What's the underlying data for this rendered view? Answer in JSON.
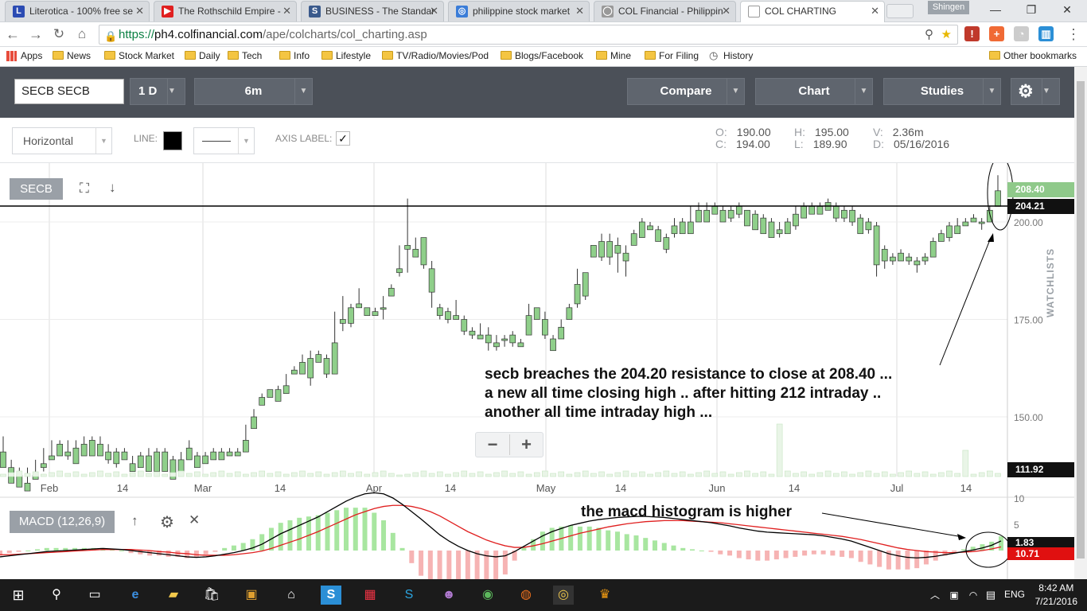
{
  "browser": {
    "tabs": [
      {
        "title": "Literotica - 100% free se",
        "icon": "literotica-favicon",
        "color": "#2b4bb3",
        "glyph": "L"
      },
      {
        "title": "The Rothschild Empire -",
        "icon": "youtube-favicon",
        "color": "#e02020",
        "glyph": "▶"
      },
      {
        "title": "BUSINESS - The Standar",
        "icon": "standard-favicon",
        "color": "#3a5a8c",
        "glyph": "S"
      },
      {
        "title": "philippine stock market",
        "icon": "globe-favicon",
        "color": "#3b7dd8",
        "glyph": "◎"
      },
      {
        "title": "COL Financial - Philippin",
        "icon": "col-favicon",
        "color": "#999999",
        "glyph": "◯"
      },
      {
        "title": "COL CHARTING",
        "icon": "blank-page-favicon",
        "color": "#ffffff",
        "glyph": ""
      }
    ],
    "profile_name": "Shingen",
    "url_scheme": "https://",
    "url_host": "ph4.colfinancial.com",
    "url_path": "/ape/colcharts/col_charting.asp",
    "bookmarks": [
      {
        "label": "Apps",
        "type": "apps"
      },
      {
        "label": "News"
      },
      {
        "label": "Stock Market"
      },
      {
        "label": "Daily"
      },
      {
        "label": "Tech"
      },
      {
        "label": "Info"
      },
      {
        "label": "Lifestyle"
      },
      {
        "label": "TV/Radio/Movies/Pod"
      },
      {
        "label": "Blogs/Facebook"
      },
      {
        "label": "Mine"
      },
      {
        "label": "For Filing"
      },
      {
        "label": "History",
        "type": "history"
      }
    ],
    "other_bookmarks": "Other bookmarks"
  },
  "toolbar": {
    "symbol": "SECB SECB",
    "interval": "1 D",
    "range": "6m",
    "compare": "Compare",
    "chart": "Chart",
    "studies": "Studies"
  },
  "drawing": {
    "tool": "Horizontal",
    "line_label": "LINE:",
    "line_color": "#000000",
    "axis_label": "AXIS LABEL:",
    "axis_checked": "✓"
  },
  "ohlc": {
    "o_key": "O:",
    "o": "190.00",
    "c_key": "C:",
    "c": "194.00",
    "h_key": "H:",
    "h": "195.00",
    "l_key": "L:",
    "l": "189.90",
    "v_key": "V:",
    "v": "2.36m",
    "d_key": "D:",
    "d": "05/16/2016"
  },
  "chart_panel": {
    "symbol_label": "SECB",
    "last_price_label": "208.40",
    "resistance_label": "204.21",
    "volume_label": "111.92",
    "watchlists": "WATCHLISTS",
    "zoom_out": "−",
    "zoom_in": "+",
    "annotation_main": "secb breaches the 204.20 resistance to close at 208.40 ...\na new all time closing high .. after hitting 212 intraday ..\nanother all time intraday high ...",
    "annotation_macd": "the macd histogram is higher",
    "macd_label": "MACD (12,26,9)",
    "macd_value_black": "1.83",
    "macd_value_red": "10.71",
    "colors": {
      "up": "#8fcf8a",
      "down": "#b8362b",
      "macd": "#000000",
      "signal": "#e01f1f",
      "hist_up": "#a8e6a0",
      "hist_down": "#f6b3b3"
    }
  },
  "chart_data": {
    "type": "candlestick",
    "price_axis_ticks": [
      "200.00",
      "175.00",
      "150.00"
    ],
    "macd_axis_ticks": [
      "10",
      "5"
    ],
    "x_ticks": [
      "Feb",
      "14",
      "Mar",
      "14",
      "Apr",
      "14",
      "May",
      "14",
      "Jun",
      "14",
      "Jul",
      "14"
    ],
    "resistance": 204.2,
    "price_range": [
      111.92,
      212
    ],
    "macd_range": [
      -4,
      12
    ],
    "candles": [
      [
        141,
        145,
        138,
        137
      ],
      [
        137,
        139,
        134,
        133
      ],
      [
        135,
        137,
        134,
        132
      ],
      [
        133,
        137,
        132,
        131
      ],
      [
        135,
        139,
        134,
        134
      ],
      [
        138,
        142,
        136,
        137
      ],
      [
        140,
        144,
        139,
        139
      ],
      [
        143,
        144,
        140,
        140
      ],
      [
        141,
        144,
        139,
        140
      ],
      [
        142,
        144,
        139,
        138
      ],
      [
        143,
        145,
        141,
        140
      ],
      [
        144,
        145,
        140,
        140
      ],
      [
        143,
        145,
        140,
        140
      ],
      [
        141,
        143,
        138,
        139
      ],
      [
        141,
        142,
        137,
        138
      ],
      [
        141,
        142,
        139,
        139
      ],
      [
        138,
        140,
        136,
        136
      ],
      [
        140,
        141,
        138,
        137
      ],
      [
        140,
        142,
        137,
        136
      ],
      [
        141,
        142,
        137,
        136
      ],
      [
        141,
        142,
        138,
        136
      ],
      [
        139,
        140,
        136,
        134
      ],
      [
        139,
        141,
        137,
        136
      ],
      [
        142,
        144,
        139,
        139
      ],
      [
        140,
        141,
        137,
        137
      ],
      [
        140,
        141,
        138,
        138
      ],
      [
        141,
        142,
        139,
        139
      ],
      [
        141,
        142,
        140,
        139
      ],
      [
        141,
        142,
        140,
        140
      ],
      [
        141,
        142,
        140,
        140
      ],
      [
        144,
        148,
        144,
        141
      ],
      [
        150,
        152,
        147,
        147
      ],
      [
        155,
        156,
        154,
        153
      ],
      [
        157,
        157,
        156,
        155
      ],
      [
        157,
        158,
        155,
        154
      ],
      [
        158,
        161,
        157,
        156
      ],
      [
        162,
        163,
        162,
        161
      ],
      [
        164,
        166,
        163,
        161
      ],
      [
        165,
        167,
        158,
        160
      ],
      [
        166,
        167,
        165,
        164
      ],
      [
        165,
        166,
        160,
        161
      ],
      [
        169,
        177,
        168,
        161
      ],
      [
        175,
        181,
        172,
        174
      ],
      [
        178,
        179,
        173,
        174
      ],
      [
        179,
        183,
        179,
        178
      ],
      [
        178,
        178,
        176,
        176
      ],
      [
        177,
        178,
        176,
        176
      ],
      [
        178,
        181,
        175,
        178
      ],
      [
        183,
        184,
        182,
        181
      ],
      [
        188,
        194,
        186,
        187
      ],
      [
        194,
        206,
        187,
        193
      ],
      [
        193,
        196,
        191,
        191
      ],
      [
        196,
        196,
        188,
        189
      ],
      [
        188,
        190,
        178,
        182
      ],
      [
        178,
        179,
        175,
        176
      ],
      [
        177,
        178,
        174,
        175
      ],
      [
        176,
        180,
        175,
        175
      ],
      [
        175,
        176,
        171,
        172
      ],
      [
        172,
        173,
        170,
        171
      ],
      [
        171,
        174,
        170,
        170
      ],
      [
        171,
        173,
        167,
        169
      ],
      [
        169,
        171,
        167,
        168
      ],
      [
        170,
        171,
        168,
        170
      ],
      [
        171,
        172,
        168,
        169
      ],
      [
        169,
        170,
        168,
        168
      ],
      [
        176,
        179,
        172,
        171
      ],
      [
        178,
        178,
        175,
        175
      ],
      [
        175,
        177,
        170,
        171
      ],
      [
        170,
        171,
        167,
        167
      ],
      [
        173,
        175,
        172,
        170
      ],
      [
        178,
        179,
        176,
        175
      ],
      [
        184,
        188,
        178,
        179
      ],
      [
        187,
        187,
        180,
        181
      ],
      [
        194,
        194,
        191,
        191
      ],
      [
        195,
        197,
        190,
        191
      ],
      [
        195,
        197,
        189,
        191
      ],
      [
        194,
        196,
        187,
        192
      ],
      [
        192,
        194,
        186,
        190
      ],
      [
        197,
        198,
        194,
        194
      ],
      [
        200,
        201,
        197,
        196
      ],
      [
        199,
        200,
        198,
        198
      ],
      [
        198,
        199,
        197,
        195
      ],
      [
        196,
        197,
        192,
        193
      ],
      [
        199,
        201,
        196,
        197
      ],
      [
        200,
        201,
        198,
        197
      ],
      [
        200,
        204,
        199,
        197
      ],
      [
        203,
        205,
        201,
        200
      ],
      [
        203,
        205,
        201,
        200
      ],
      [
        204,
        205,
        203,
        202
      ],
      [
        203,
        204,
        201,
        200
      ],
      [
        203,
        204,
        200,
        201
      ],
      [
        204,
        205,
        201,
        202
      ],
      [
        203,
        203,
        201,
        199
      ],
      [
        202,
        203,
        199,
        198
      ],
      [
        201,
        202,
        198,
        197
      ],
      [
        200,
        201,
        196,
        196
      ],
      [
        198,
        200,
        196,
        197
      ],
      [
        200,
        201,
        198,
        197
      ],
      [
        202,
        204,
        198,
        199
      ],
      [
        204,
        205,
        203,
        201
      ],
      [
        204,
        205,
        203,
        202
      ],
      [
        204,
        205,
        202,
        202
      ],
      [
        205,
        206,
        204,
        203
      ],
      [
        204,
        205,
        200,
        201
      ],
      [
        203,
        204,
        200,
        201
      ],
      [
        203,
        204,
        199,
        200
      ],
      [
        201,
        202,
        197,
        197
      ],
      [
        200,
        201,
        197,
        198
      ],
      [
        199,
        200,
        186,
        189
      ],
      [
        193,
        194,
        188,
        190
      ],
      [
        191,
        192,
        189,
        190
      ],
      [
        192,
        193,
        190,
        190
      ],
      [
        191,
        192,
        189,
        190
      ],
      [
        190,
        191,
        187,
        189
      ],
      [
        191,
        192,
        189,
        190
      ],
      [
        195,
        196,
        192,
        191
      ],
      [
        197,
        198,
        195,
        195
      ],
      [
        199,
        200,
        195,
        196
      ],
      [
        199,
        201,
        197,
        197
      ],
      [
        200,
        201,
        199,
        199
      ],
      [
        201,
        202,
        200,
        200
      ],
      [
        200,
        201,
        198,
        200
      ],
      [
        203,
        204,
        200,
        200
      ],
      [
        208,
        212,
        207,
        204
      ]
    ],
    "macd": [
      -1.2,
      -1.0,
      -0.8,
      -0.6,
      -0.4,
      -0.2,
      -0.1,
      0.0,
      0.1,
      0.2,
      0.3,
      0.4,
      0.3,
      0.2,
      0.0,
      -0.2,
      -0.4,
      -0.6,
      -0.8,
      -1.0,
      -1.2,
      -1.3,
      -1.2,
      -1.0,
      -0.7,
      -0.4,
      0.0,
      0.5,
      1.2,
      2.2,
      3.2,
      4.0,
      4.8,
      5.6,
      6.4,
      7.4,
      8.4,
      9.4,
      10.2,
      10.8,
      11.0,
      10.8,
      10.0,
      8.8,
      7.4,
      6.0,
      4.5,
      3.0,
      1.8,
      0.8,
      0.0,
      -0.6,
      -1.0,
      -1.2,
      -1.0,
      -0.2,
      0.8,
      1.8,
      2.8,
      3.6,
      4.2,
      4.8,
      5.2,
      5.6,
      5.9,
      6.1,
      6.3,
      6.4,
      6.5,
      6.5,
      6.4,
      6.3,
      6.1,
      5.9,
      5.7,
      5.5,
      5.3,
      5.0,
      4.7,
      4.3,
      4.0,
      3.7,
      3.5,
      3.4,
      3.3,
      3.2,
      3.1,
      3.0,
      2.8,
      2.5,
      2.2,
      1.8,
      1.2,
      0.6,
      0.0,
      -0.6,
      -1.0,
      -1.3,
      -1.4,
      -1.3,
      -1.1,
      -0.8,
      -0.5,
      -0.2,
      0.1,
      0.5,
      1.0,
      1.83
    ],
    "signal": [
      -0.8,
      -0.8,
      -0.7,
      -0.6,
      -0.5,
      -0.4,
      -0.3,
      -0.2,
      -0.1,
      0.0,
      0.1,
      0.2,
      0.2,
      0.2,
      0.2,
      0.1,
      0.0,
      -0.2,
      -0.3,
      -0.5,
      -0.6,
      -0.8,
      -0.9,
      -0.9,
      -0.9,
      -0.8,
      -0.6,
      -0.4,
      -0.1,
      0.4,
      1.0,
      1.6,
      2.2,
      2.9,
      3.6,
      4.4,
      5.2,
      6.0,
      6.8,
      7.4,
      8.0,
      8.4,
      8.6,
      8.6,
      8.4,
      8.0,
      7.4,
      6.6,
      5.6,
      4.6,
      3.6,
      2.8,
      2.0,
      1.4,
      0.9,
      0.6,
      0.6,
      0.9,
      1.3,
      1.8,
      2.3,
      2.8,
      3.3,
      3.7,
      4.1,
      4.5,
      4.8,
      5.1,
      5.3,
      5.5,
      5.6,
      5.7,
      5.7,
      5.7,
      5.6,
      5.5,
      5.4,
      5.3,
      5.1,
      4.9,
      4.7,
      4.5,
      4.3,
      4.1,
      3.9,
      3.7,
      3.5,
      3.3,
      3.1,
      2.9,
      2.7,
      2.4,
      2.1,
      1.7,
      1.3,
      0.9,
      0.5,
      0.2,
      0.0,
      -0.2,
      -0.3,
      -0.4,
      -0.4,
      -0.3,
      -0.2,
      0.0,
      0.3,
      0.7
    ]
  },
  "taskbar": {
    "time": "8:42 AM",
    "date": "7/21/2016",
    "lang": "ENG"
  }
}
